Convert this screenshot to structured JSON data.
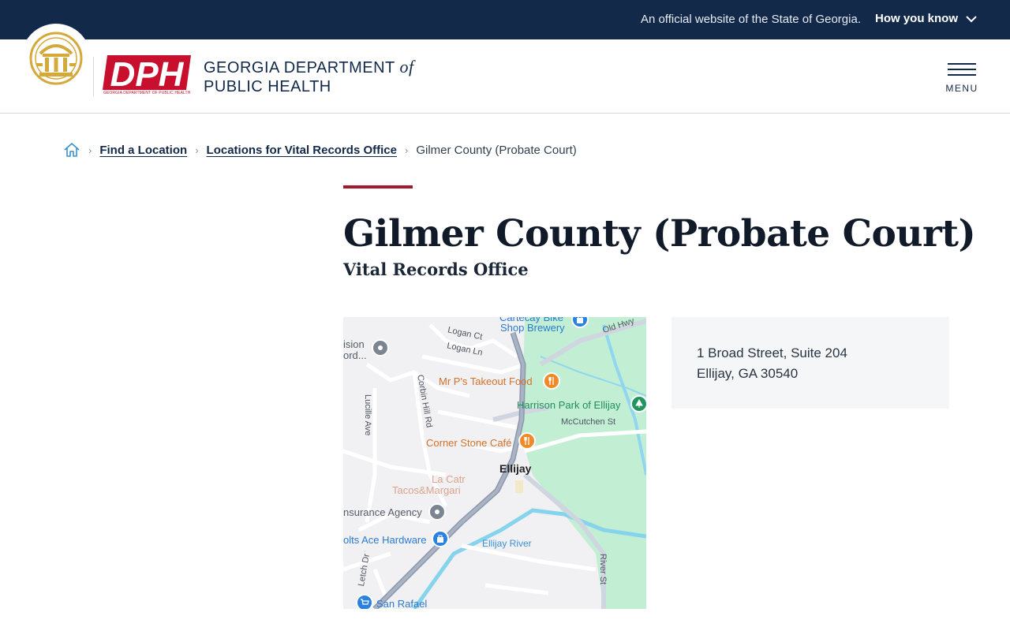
{
  "banner": {
    "official_text": "An official website of the State of Georgia.",
    "how_you_know": "How you know"
  },
  "header": {
    "logo_text": "DPH",
    "logo_subtext": "GEORGIA DEPARTMENT OF PUBLIC HEALTH",
    "org_line1_a": "GEORGIA DEPARTMENT ",
    "org_line1_of": "of",
    "org_line2": "PUBLIC HEALTH",
    "menu_label": "MENU"
  },
  "breadcrumb": {
    "items": [
      {
        "label": "Find a Location"
      },
      {
        "label": "Locations for Vital Records Office"
      }
    ],
    "current": "Gilmer County (Probate Court)"
  },
  "page": {
    "title": "Gilmer County (Probate Court)",
    "subtitle": "Vital Records Office"
  },
  "map": {
    "labels": {
      "brewery": "Cartecay Bike",
      "brewery2": "Shop Brewery",
      "old_hwy": "Old Hwy",
      "logan_ct": "Logan Ct",
      "logan_ln": "Logan Ln",
      "vision1": "ision",
      "vision2": "ord...",
      "mr_p": "Mr P's Takeout Food",
      "lucille": "Lucille Ave",
      "corbin": "Corbin Hill Rd",
      "harrison": "Harrison Park of Ellijay",
      "mccutchen": "McCutchen St",
      "cornerstone": "Corner Stone Café",
      "ellijay": "Ellijay",
      "la_catr": "La Catr",
      "tacos": "Tacos&Margari",
      "insurance": "nsurance Agency",
      "hardware": "olts Ace Hardware",
      "ellijay_river": "Ellijay River",
      "river_st": "River St",
      "letch_dr": "Letch Dr",
      "san_rafael": "San Rafael"
    }
  },
  "address": {
    "line1": "1 Broad Street, Suite 204",
    "line2": "Ellijay, GA 30540"
  },
  "colors": {
    "navy": "#12294a",
    "accent_red": "#a3192e",
    "dph_red": "#c8102e",
    "seal_gold": "#d4a93a"
  }
}
